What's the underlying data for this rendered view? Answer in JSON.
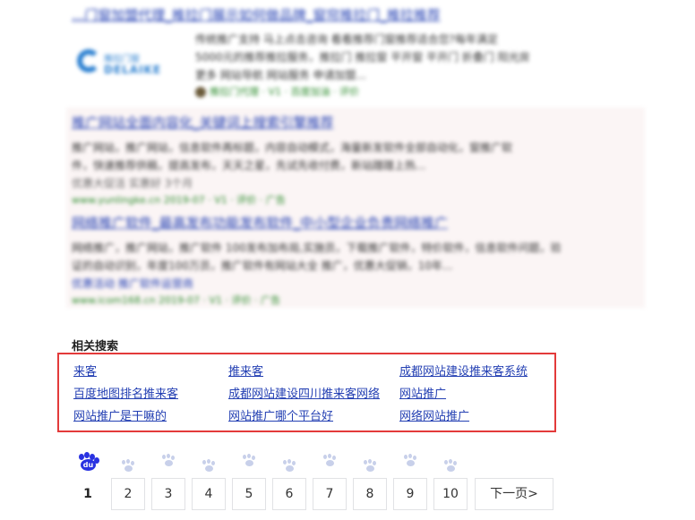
{
  "results_blurred": {
    "r1": {
      "title": "...门窗加盟代理_推拉门展示如何做品牌_窗帘推拉门_推拉推荐",
      "lines": [
        "传统推广支持 马上点击咨询 看看推荐门窗推荐适合您?每年满足",
        "5000元的推荐推拉服务，推拉门 推拉窗 平开窗 平开门 折叠门 阳光房",
        "更多 网站导航 网站服务 申请加盟..."
      ],
      "source": "推拉门代理 · V1 · 百度加油 · 评价",
      "logo_brand": "推拉门窗",
      "logo_brand2": "DELAIKE"
    },
    "r2": {
      "title": "推广网站全面内容化_关键词上搜索引擎推荐",
      "lines": [
        "推广网站，推广网站，信息软件再标题，内容自动模式，海量新发软件全部自动化，窗推广软",
        "件，快速推荐供稿，提高发布，天天之星，先试先收付费，新站蹭蹭上热..."
      ],
      "sub": "优惠大促活 实惠好 3个月",
      "source": "www.yunlingke.cn  2019-07  ·  V1 · 评价 · 广告"
    },
    "r3": {
      "title": "网络推广软件_最高发布功能发布软件_中小型企业负责网络推广",
      "lines": [
        "网络推广，推广网站，推广软件 100发布加布局,实施员，下载推广软件，特价软件，信息软件问题，验",
        "证的自动识别，年度100万员，推广软件有网站大全 推广，优惠大促销，10年..."
      ],
      "sub": "优惠活动 推广软件运营商",
      "source": "www.icom168.cn  2019-07  ·  V1 · 评价 · 广告"
    }
  },
  "related": {
    "title": "相关搜索",
    "links": [
      "来客",
      "推来客",
      "成都网站建设推来客系统",
      "百度地图排名推来客",
      "成都网站建设四川推来客网络",
      "网站推广",
      "网站推广是干嘛的",
      "网站推广哪个平台好",
      "网络网站推广"
    ]
  },
  "pagination": {
    "current": "1",
    "pages": [
      "2",
      "3",
      "4",
      "5",
      "6",
      "7",
      "8",
      "9",
      "10"
    ],
    "next": "下一页>",
    "logo_text": "du"
  }
}
